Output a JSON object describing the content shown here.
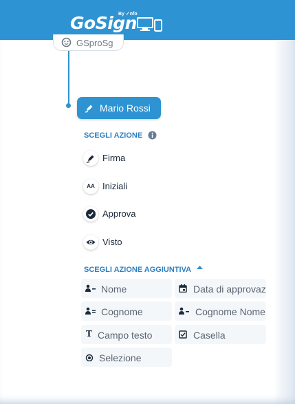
{
  "header": {
    "logo_text": "GoSign",
    "logo_byline": "By InfoCert",
    "brand_color": "#2e93d2"
  },
  "workflow": {
    "previous_step_label": "GSproSg",
    "signer": {
      "name": "Mario Rossi",
      "icon": "signature-pen-icon"
    }
  },
  "actions": {
    "title": "SCEGLI AZIONE",
    "info_icon": "info-icon",
    "items": [
      {
        "label": "Firma",
        "icon": "signature-pen-icon"
      },
      {
        "label": "Iniziali",
        "icon": "initials-icon",
        "glyph": "AA"
      },
      {
        "label": "Approva",
        "icon": "check-circle-icon"
      },
      {
        "label": "Visto",
        "icon": "eye-icon"
      }
    ]
  },
  "additional_actions": {
    "title": "SCEGLI AZIONE AGGIUNTIVA",
    "toggle_icon": "caret-up-icon",
    "fields": [
      {
        "label": "Nome",
        "icon": "person-dash-icon"
      },
      {
        "label": "Data di approvazione",
        "icon": "calendar-icon"
      },
      {
        "label": "Cognome",
        "icon": "person-lines-icon"
      },
      {
        "label": "Cognome Nome",
        "icon": "person-dash-icon"
      },
      {
        "label": "Campo testo",
        "icon": "text-t-icon",
        "glyph": "T"
      },
      {
        "label": "Casella",
        "icon": "checkbox-icon"
      },
      {
        "label": "Selezione",
        "icon": "radio-icon"
      }
    ]
  }
}
